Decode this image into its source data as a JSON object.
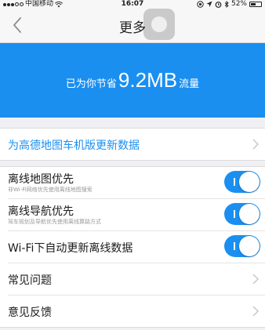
{
  "status_bar": {
    "carrier": "中国移动",
    "time": "16:07",
    "battery_percent": "52%",
    "battery_level": 0.52,
    "icons": [
      "signal-dots-icon",
      "wifi-icon",
      "location-lock-icon",
      "location-arrow-icon",
      "alarm-icon",
      "bluetooth-icon",
      "battery-icon"
    ]
  },
  "nav": {
    "title": "更多",
    "back_icon": "chevron-left-icon"
  },
  "banner": {
    "prefix": "已为你节省",
    "value": "9.2MB",
    "suffix": "流量",
    "bg_color": "#1a8ff0"
  },
  "car_update": {
    "label": "为高德地图车机版更新数据"
  },
  "settings": [
    {
      "title": "离线地图优先",
      "subtitle": "非Wi-Fi网络优先使用离线地图搜索",
      "toggle_on": true
    },
    {
      "title": "离线导航优先",
      "subtitle": "驾车规划及导航优先使用离线算路方式",
      "toggle_on": true
    },
    {
      "title": "Wi-Fi下自动更新离线数据",
      "toggle_on": true
    }
  ],
  "links": [
    {
      "label": "常见问题"
    },
    {
      "label": "意见反馈"
    }
  ],
  "accent_color": "#1a8ff0"
}
